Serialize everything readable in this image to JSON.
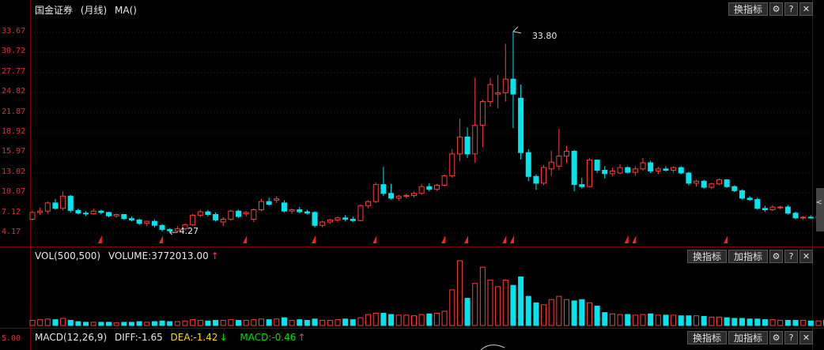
{
  "main": {
    "title": "国金证券",
    "period": "(月线)",
    "indicator": "MA()",
    "buttons": {
      "switch": "换指标"
    },
    "high_label": "33.80",
    "low_label": "4.27"
  },
  "vol": {
    "title": "VOL(500,500)",
    "volume_text": "VOLUME:3772013.00",
    "arrow": "↑",
    "buttons": {
      "switch": "换指标",
      "add": "加指标"
    }
  },
  "macd": {
    "title": "MACD(12,26,9)",
    "diff": "DIFF:-1.65",
    "dea": "DEA:-1.42",
    "dea_arrow": "↓",
    "macd": "MACD:-0.46",
    "macd_arrow": "↑",
    "axis_value": "5.00",
    "buttons": {
      "switch": "换指标",
      "add": "加指标"
    }
  },
  "icons": {
    "gear": "gear-icon",
    "help": "help-icon",
    "close": "close-icon"
  },
  "colors": {
    "up": "#ff3b3b",
    "down": "#00e5ee",
    "axis": "#e03030",
    "grid": "#7a0000",
    "bg": "#000000"
  },
  "chart_data": {
    "type": "candlestick",
    "y_ticks": [
      "33.67",
      "30.72",
      "27.77",
      "24.82",
      "21.87",
      "18.92",
      "15.97",
      "13.02",
      "10.07",
      "7.12",
      "4.17"
    ],
    "ylim": [
      2.8,
      35.5
    ],
    "candles": [
      [
        6.2,
        7.5,
        6.0,
        7.2
      ],
      [
        7.2,
        7.9,
        6.8,
        7.4
      ],
      [
        7.4,
        8.8,
        7.0,
        8.6
      ],
      [
        8.6,
        9.2,
        7.6,
        7.8
      ],
      [
        7.8,
        10.3,
        7.5,
        9.6
      ],
      [
        9.6,
        9.8,
        7.2,
        7.5
      ],
      [
        7.5,
        7.8,
        6.9,
        7.1
      ],
      [
        7.1,
        7.4,
        6.7,
        7.0
      ],
      [
        7.0,
        7.8,
        6.9,
        7.4
      ],
      [
        7.4,
        7.6,
        6.9,
        7.2
      ],
      [
        7.2,
        7.3,
        6.5,
        6.7
      ],
      [
        6.7,
        7.0,
        6.4,
        6.9
      ],
      [
        6.9,
        7.0,
        6.1,
        6.3
      ],
      [
        6.3,
        6.6,
        5.9,
        6.1
      ],
      [
        6.1,
        6.3,
        5.4,
        5.6
      ],
      [
        5.6,
        6.0,
        5.2,
        5.9
      ],
      [
        5.9,
        6.2,
        5.0,
        5.3
      ],
      [
        5.3,
        5.5,
        4.4,
        4.7
      ],
      [
        4.7,
        4.9,
        4.27,
        4.5
      ],
      [
        4.5,
        5.2,
        4.3,
        4.8
      ],
      [
        4.8,
        5.6,
        4.5,
        5.4
      ],
      [
        5.4,
        7.0,
        5.2,
        6.8
      ],
      [
        6.8,
        7.6,
        6.5,
        7.3
      ],
      [
        7.3,
        7.6,
        6.6,
        6.9
      ],
      [
        6.9,
        7.2,
        5.9,
        6.1
      ],
      [
        5.8,
        6.5,
        5.2,
        6.2
      ],
      [
        6.2,
        7.6,
        6.0,
        7.4
      ],
      [
        7.4,
        7.6,
        6.4,
        6.6
      ],
      [
        7.0,
        7.4,
        6.6,
        7.2
      ],
      [
        6.2,
        7.8,
        5.8,
        7.6
      ],
      [
        7.6,
        9.2,
        7.4,
        8.8
      ],
      [
        8.8,
        9.4,
        8.2,
        8.4
      ],
      [
        9.0,
        9.6,
        8.6,
        9.2
      ],
      [
        8.6,
        9.0,
        7.2,
        7.4
      ],
      [
        7.4,
        7.8,
        7.0,
        7.6
      ],
      [
        7.6,
        8.0,
        7.1,
        7.3
      ],
      [
        7.3,
        7.6,
        6.9,
        7.1
      ],
      [
        7.2,
        7.4,
        5.0,
        5.3
      ],
      [
        5.3,
        6.0,
        5.0,
        5.8
      ],
      [
        5.8,
        6.3,
        5.5,
        6.1
      ],
      [
        6.1,
        6.6,
        5.8,
        6.4
      ],
      [
        6.4,
        6.8,
        5.9,
        6.2
      ],
      [
        6.2,
        6.6,
        5.8,
        6.0
      ],
      [
        6.0,
        8.4,
        5.9,
        8.2
      ],
      [
        8.2,
        9.0,
        7.8,
        8.8
      ],
      [
        8.8,
        11.6,
        8.6,
        11.3
      ],
      [
        11.3,
        13.9,
        9.6,
        10.0
      ],
      [
        10.0,
        11.4,
        9.1,
        9.3
      ],
      [
        9.3,
        9.8,
        8.9,
        9.6
      ],
      [
        9.6,
        10.0,
        9.3,
        9.7
      ],
      [
        9.7,
        10.3,
        9.4,
        10.0
      ],
      [
        10.0,
        11.4,
        9.8,
        11.0
      ],
      [
        11.0,
        11.5,
        10.3,
        10.6
      ],
      [
        10.6,
        11.4,
        10.4,
        11.2
      ],
      [
        11.2,
        12.8,
        11.0,
        12.6
      ],
      [
        12.6,
        16.5,
        12.3,
        15.8
      ],
      [
        15.8,
        21.0,
        14.7,
        18.3
      ],
      [
        18.3,
        19.7,
        15.2,
        15.8
      ],
      [
        15.8,
        27.0,
        14.5,
        20.0
      ],
      [
        20.0,
        23.8,
        16.8,
        23.5
      ],
      [
        23.5,
        27.0,
        22.8,
        26.0
      ],
      [
        24.6,
        27.4,
        22.5,
        24.8
      ],
      [
        24.8,
        32.0,
        23.5,
        26.8
      ],
      [
        26.8,
        33.8,
        19.6,
        24.6
      ],
      [
        24.0,
        26.0,
        15.0,
        16.0
      ],
      [
        16.0,
        16.5,
        11.8,
        12.5
      ],
      [
        12.5,
        12.8,
        10.5,
        11.5
      ],
      [
        11.5,
        14.2,
        11.2,
        13.8
      ],
      [
        13.6,
        16.3,
        12.6,
        14.6
      ],
      [
        14.0,
        19.5,
        13.4,
        15.5
      ],
      [
        15.5,
        17.0,
        14.5,
        16.2
      ],
      [
        16.2,
        16.4,
        10.3,
        11.3
      ],
      [
        11.3,
        12.3,
        10.7,
        11.0
      ],
      [
        11.0,
        15.2,
        10.9,
        14.9
      ],
      [
        14.9,
        15.0,
        13.0,
        13.4
      ],
      [
        13.4,
        14.0,
        12.2,
        12.9
      ],
      [
        12.9,
        13.8,
        12.5,
        13.3
      ],
      [
        13.0,
        14.3,
        12.8,
        13.8
      ],
      [
        13.8,
        14.0,
        12.9,
        13.1
      ],
      [
        13.1,
        14.0,
        12.6,
        13.6
      ],
      [
        13.6,
        15.2,
        13.3,
        14.5
      ],
      [
        14.5,
        14.8,
        13.0,
        13.3
      ],
      [
        13.3,
        13.9,
        12.8,
        13.6
      ],
      [
        13.6,
        14.0,
        13.2,
        13.4
      ],
      [
        13.4,
        14.0,
        13.0,
        13.8
      ],
      [
        13.8,
        14.0,
        12.8,
        13.0
      ],
      [
        13.0,
        13.2,
        11.2,
        11.5
      ],
      [
        11.5,
        12.0,
        11.0,
        11.8
      ],
      [
        11.8,
        12.0,
        10.7,
        10.9
      ],
      [
        10.9,
        11.6,
        10.6,
        11.4
      ],
      [
        11.4,
        12.2,
        11.2,
        12.0
      ],
      [
        12.0,
        12.1,
        10.8,
        11.0
      ],
      [
        11.0,
        11.2,
        10.2,
        10.4
      ],
      [
        10.4,
        10.6,
        9.1,
        9.3
      ],
      [
        9.3,
        9.6,
        8.9,
        9.1
      ],
      [
        9.1,
        9.4,
        7.6,
        7.8
      ],
      [
        7.8,
        8.2,
        7.3,
        7.6
      ],
      [
        7.6,
        8.3,
        7.4,
        8.0
      ],
      [
        8.0,
        8.2,
        7.7,
        8.0
      ],
      [
        8.0,
        8.3,
        6.9,
        7.1
      ],
      [
        7.1,
        7.3,
        6.2,
        6.4
      ],
      [
        6.4,
        6.7,
        6.1,
        6.5
      ],
      [
        6.5,
        6.8,
        6.3,
        6.4
      ],
      [
        6.4,
        6.9,
        6.2,
        6.6
      ],
      [
        6.6,
        6.8,
        5.6,
        6.5
      ]
    ],
    "volumes": [
      8,
      9,
      10,
      9,
      11,
      8,
      6,
      5,
      5,
      5,
      5,
      4,
      5,
      5,
      6,
      5,
      6,
      7,
      6,
      6,
      7,
      9,
      8,
      7,
      8,
      8,
      9,
      8,
      8,
      9,
      10,
      9,
      10,
      12,
      8,
      9,
      8,
      10,
      8,
      8,
      9,
      10,
      9,
      12,
      17,
      19,
      19,
      17,
      16,
      16,
      15,
      17,
      18,
      19,
      22,
      55,
      100,
      42,
      65,
      90,
      70,
      60,
      70,
      62,
      75,
      45,
      35,
      32,
      40,
      45,
      40,
      38,
      40,
      35,
      30,
      20,
      18,
      17,
      17,
      16,
      17,
      18,
      16,
      16,
      16,
      15,
      15,
      15,
      14,
      13,
      13,
      12,
      11,
      11,
      10,
      10,
      9,
      9,
      8,
      8,
      8,
      8,
      7,
      7,
      8,
      8
    ],
    "markers_index": [
      9,
      17,
      28,
      37,
      45,
      54,
      57,
      62,
      63,
      78,
      79,
      91,
      105
    ]
  }
}
